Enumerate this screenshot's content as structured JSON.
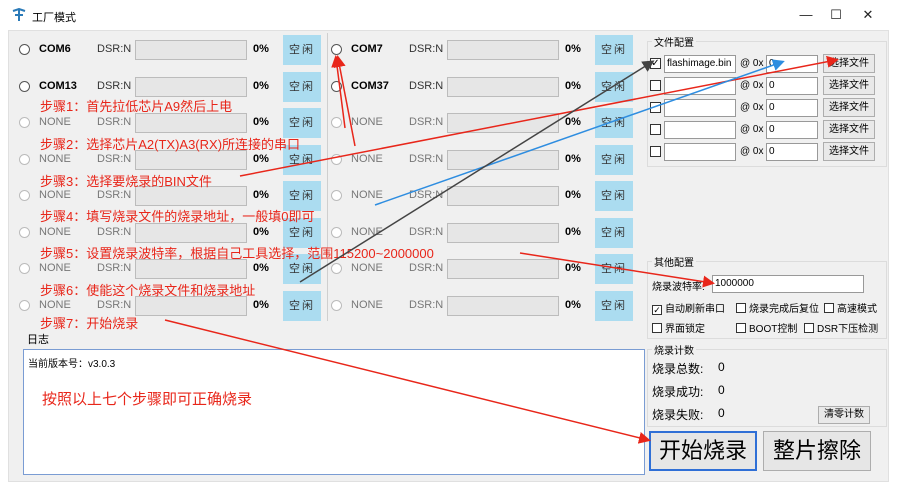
{
  "window": {
    "title": "工厂模式",
    "min_symbol": "—",
    "max_symbol": "☐",
    "close_symbol": "✕"
  },
  "ports": [
    {
      "name": "COM6",
      "dsr": "DSR:N",
      "pct": "0%",
      "state": "空闲",
      "active": true
    },
    {
      "name": "COM7",
      "dsr": "DSR:N",
      "pct": "0%",
      "state": "空闲",
      "active": true
    },
    {
      "name": "COM13",
      "dsr": "DSR:N",
      "pct": "0%",
      "state": "空闲",
      "active": true
    },
    {
      "name": "COM37",
      "dsr": "DSR:N",
      "pct": "0%",
      "state": "空闲",
      "active": true
    },
    {
      "name": "NONE",
      "dsr": "DSR:N",
      "pct": "0%",
      "state": "空闲",
      "active": false
    },
    {
      "name": "NONE",
      "dsr": "DSR:N",
      "pct": "0%",
      "state": "空闲",
      "active": false
    },
    {
      "name": "NONE",
      "dsr": "DSR:N",
      "pct": "0%",
      "state": "空闲",
      "active": false
    },
    {
      "name": "NONE",
      "dsr": "DSR:N",
      "pct": "0%",
      "state": "空闲",
      "active": false
    },
    {
      "name": "NONE",
      "dsr": "DSR:N",
      "pct": "0%",
      "state": "空闲",
      "active": false
    },
    {
      "name": "NONE",
      "dsr": "DSR:N",
      "pct": "0%",
      "state": "空闲",
      "active": false
    },
    {
      "name": "NONE",
      "dsr": "DSR:N",
      "pct": "0%",
      "state": "空闲",
      "active": false
    },
    {
      "name": "NONE",
      "dsr": "DSR:N",
      "pct": "0%",
      "state": "空闲",
      "active": false
    },
    {
      "name": "NONE",
      "dsr": "DSR:N",
      "pct": "0%",
      "state": "空闲",
      "active": false
    },
    {
      "name": "NONE",
      "dsr": "DSR:N",
      "pct": "0%",
      "state": "空闲",
      "active": false
    },
    {
      "name": "NONE",
      "dsr": "DSR:N",
      "pct": "0%",
      "state": "空闲",
      "active": false
    },
    {
      "name": "NONE",
      "dsr": "DSR:N",
      "pct": "0%",
      "state": "空闲",
      "active": false
    }
  ],
  "log": {
    "label": "日志",
    "version": "当前版本号：v3.0.3",
    "note": "按照以上七个步骤即可正确烧录"
  },
  "file_config": {
    "title": "文件配置",
    "at_label": "@ 0x",
    "pick_label": "选择文件",
    "check_mark": "✓",
    "files": [
      {
        "checked": true,
        "name": "flashimage.bin",
        "addr": "0"
      },
      {
        "checked": false,
        "name": "",
        "addr": "0"
      },
      {
        "checked": false,
        "name": "",
        "addr": "0"
      },
      {
        "checked": false,
        "name": "",
        "addr": "0"
      },
      {
        "checked": false,
        "name": "",
        "addr": "0"
      }
    ]
  },
  "other_config": {
    "title": "其他配置",
    "baud_label": "烧录波特率:",
    "baud_value": "1000000",
    "options": [
      {
        "label": "自动刷新串口",
        "checked": true
      },
      {
        "label": "烧录完成后复位",
        "checked": false
      },
      {
        "label": "高速模式",
        "checked": false
      },
      {
        "label": "界面锁定",
        "checked": false
      },
      {
        "label": "BOOT控制",
        "checked": false
      },
      {
        "label": "DSR下压检测",
        "checked": false
      }
    ]
  },
  "counts": {
    "title": "烧录计数",
    "total_label": "烧录总数:",
    "total": "0",
    "success_label": "烧录成功:",
    "success": "0",
    "fail_label": "烧录失败:",
    "fail": "0",
    "clear_label": "清零计数"
  },
  "actions": {
    "start_label": "开始烧录",
    "erase_label": "整片擦除"
  },
  "steps": [
    "步骤1：首先拉低芯片A9然后上电",
    "步骤2：选择芯片A2(TX)A3(RX)所连接的串口",
    "步骤3：选择要烧录的BIN文件",
    "步骤4：填写烧录文件的烧录地址，一般填0即可",
    "步骤5：设置烧录波特率，根据自己工具选择，范围115200~2000000",
    "步骤6：使能这个烧录文件和烧录地址",
    "步骤7：开始烧录"
  ],
  "colors": {
    "annotation": "#e8261a",
    "status_bg": "#abdcf0",
    "arrow_blue": "#2e8de0",
    "arrow_dark": "#444444"
  }
}
